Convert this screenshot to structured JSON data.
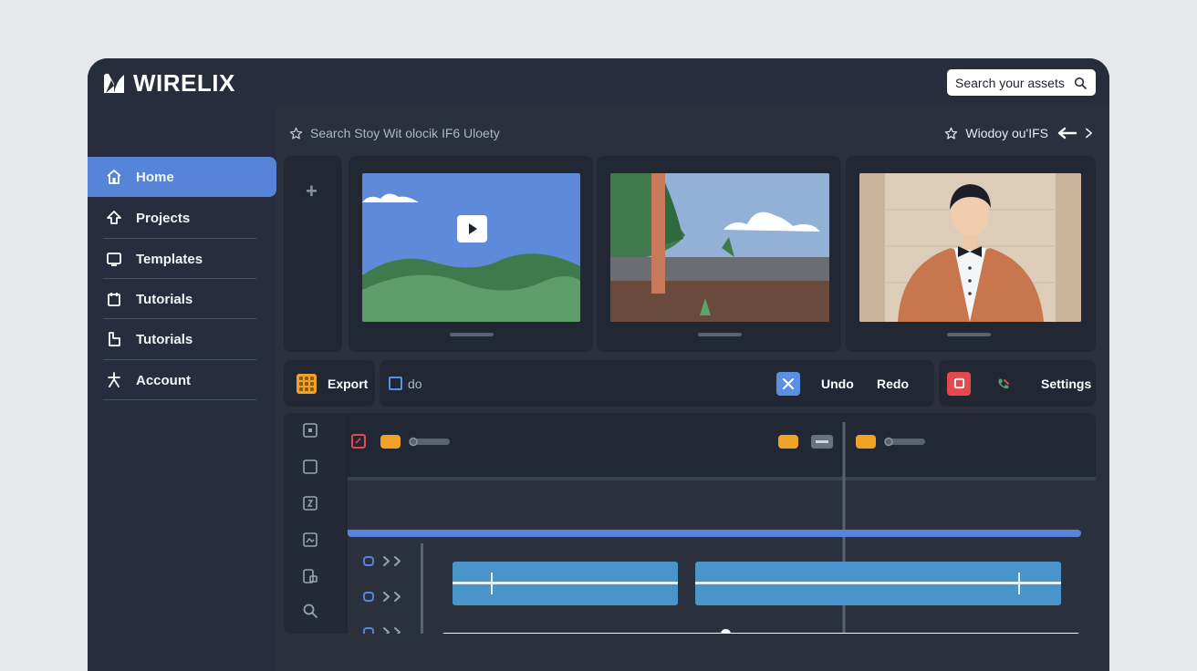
{
  "app": {
    "logo_text": "WIRELIX",
    "search_label": "Search your assets"
  },
  "sidebar": {
    "items": [
      {
        "label": "Home",
        "icon": "home-icon",
        "active": true
      },
      {
        "label": "Projects",
        "icon": "upload-arrow-icon"
      },
      {
        "label": "Templates",
        "icon": "monitor-icon"
      },
      {
        "label": "Tutorials",
        "icon": "clipboard-icon"
      },
      {
        "label": "Tutorials",
        "icon": "bookmark-icon"
      },
      {
        "label": "Account",
        "icon": "person-star-icon"
      }
    ]
  },
  "breadcrumb": {
    "left_text": "Search Stoy Wit olocik IF6 Uloety",
    "right_text": "Wiodoy ou'IFS"
  },
  "toolbar": {
    "export_label": "Export",
    "checkbox_label": "do",
    "undo_label": "Undo",
    "redo_label": "Redo",
    "settings_label": "Settings"
  },
  "timeline": {
    "playhead_position": 0.46,
    "scrubber_position": 0.44
  },
  "colors": {
    "accent": "#5584d8",
    "orange": "#f0a226",
    "red": "#e5484f",
    "clip_blue": "#4a94cc",
    "track_blue": "#5584d8"
  }
}
